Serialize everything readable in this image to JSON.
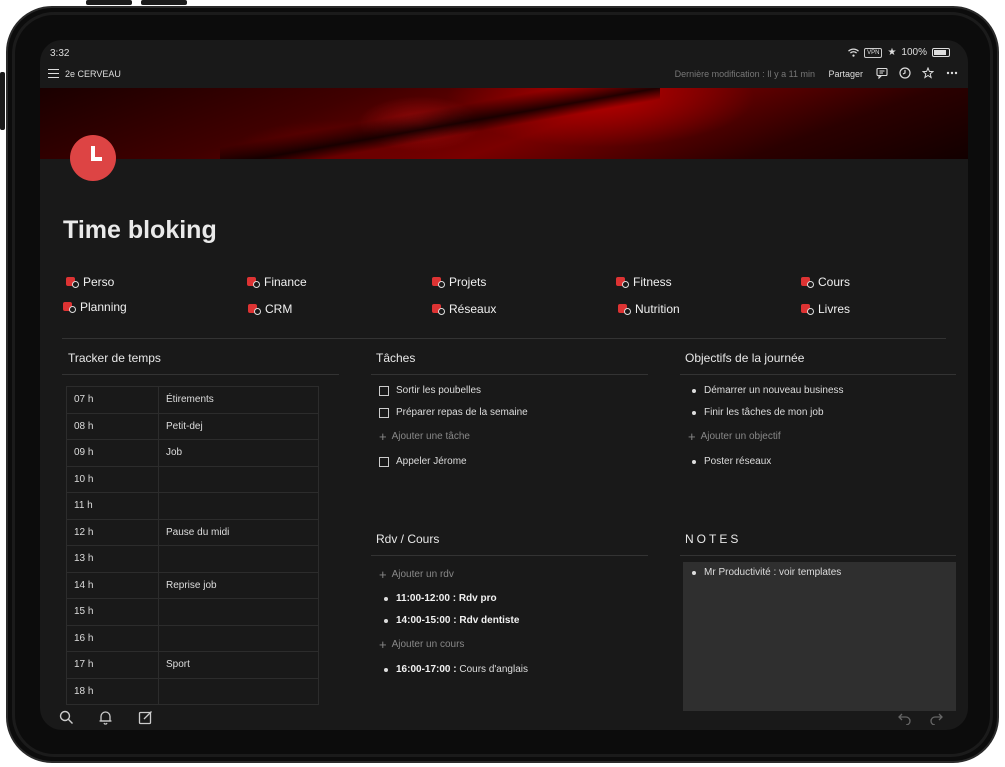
{
  "status": {
    "time": "3:32",
    "vpn": "VPN",
    "battery": "100%"
  },
  "topbar": {
    "workspace": "2e CERVEAU",
    "last_modified": "Dernière modification : Il y a 11 min",
    "share_label": "Partager"
  },
  "page": {
    "title": "Time bloking"
  },
  "links": [
    {
      "label": "Perso"
    },
    {
      "label": "Finance"
    },
    {
      "label": "Projets"
    },
    {
      "label": "Fitness"
    },
    {
      "label": "Cours"
    },
    {
      "label": "Planning"
    },
    {
      "label": "CRM"
    },
    {
      "label": "Réseaux"
    },
    {
      "label": "Nutrition"
    },
    {
      "label": "Livres"
    }
  ],
  "tracker": {
    "title": "Tracker de temps",
    "rows": [
      {
        "hour": "07 h",
        "activity": "Étirements"
      },
      {
        "hour": "08 h",
        "activity": "Petit-dej"
      },
      {
        "hour": "09 h",
        "activity": "Job"
      },
      {
        "hour": "10 h",
        "activity": ""
      },
      {
        "hour": "11 h",
        "activity": ""
      },
      {
        "hour": "12 h",
        "activity": "Pause du midi"
      },
      {
        "hour": "13 h",
        "activity": ""
      },
      {
        "hour": "14 h",
        "activity": "Reprise job"
      },
      {
        "hour": "15 h",
        "activity": ""
      },
      {
        "hour": "16 h",
        "activity": ""
      },
      {
        "hour": "17 h",
        "activity": "Sport"
      },
      {
        "hour": "18 h",
        "activity": ""
      }
    ]
  },
  "tasks": {
    "title": "Tâches",
    "items": [
      "Sortir les poubelles",
      "Préparer repas de la semaine",
      "Appeler Jérome"
    ],
    "add_label": "Ajouter une tâche"
  },
  "objectives": {
    "title": "Objectifs de la journée",
    "items": [
      "Démarrer un nouveau business",
      "Finir les tâches de mon job",
      "Poster réseaux"
    ],
    "add_label": "Ajouter un objectif"
  },
  "rdv": {
    "title": "Rdv / Cours",
    "add_rdv_label": "Ajouter un rdv",
    "rdv_items": [
      {
        "time": "11:00-12:00 :",
        "label": "Rdv pro"
      },
      {
        "time": "14:00-15:00 :",
        "label": "Rdv dentiste"
      }
    ],
    "add_course_label": "Ajouter un cours",
    "course_items": [
      {
        "time": "16:00-17:00 :",
        "label": "Cours d'anglais"
      }
    ]
  },
  "notes": {
    "title": "NOTES",
    "items": [
      "Mr Productivité : voir templates"
    ]
  },
  "colors": {
    "accent": "#dd4444",
    "background": "#191919",
    "cover": "#8b0000"
  },
  "icons": [
    "menu-icon",
    "wifi-icon",
    "star-icon",
    "comment-icon",
    "clock-icon",
    "more-icon",
    "search-icon",
    "bell-icon",
    "edit-icon",
    "undo-icon",
    "redo-icon"
  ]
}
